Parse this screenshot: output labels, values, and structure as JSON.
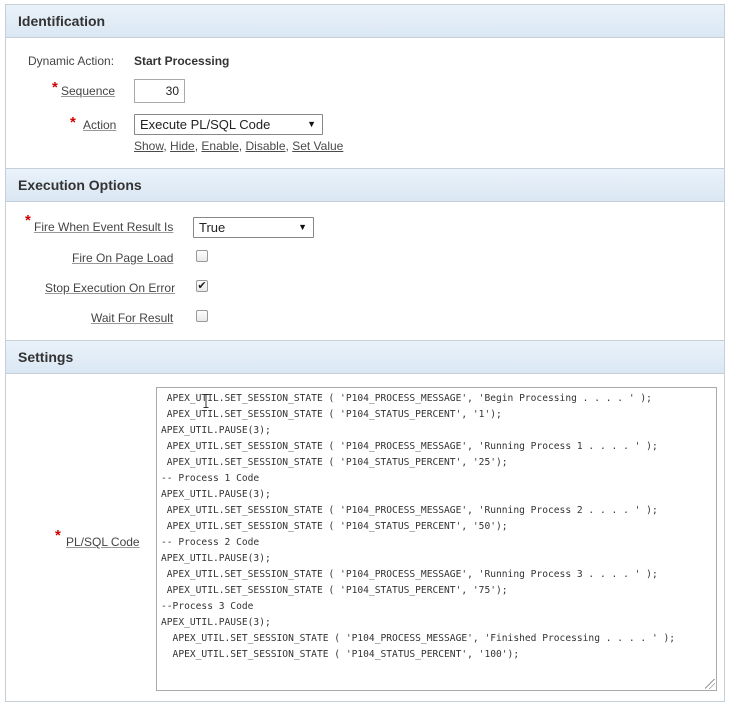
{
  "identification": {
    "header": "Identification",
    "dynamic_action_label": "Dynamic Action:",
    "dynamic_action_value": "Start Processing",
    "sequence_label": "Sequence",
    "sequence_value": "30",
    "action_label": "Action",
    "action_value": "Execute PL/SQL Code",
    "action_links": [
      "Show",
      "Hide",
      "Enable",
      "Disable",
      "Set Value"
    ]
  },
  "execution": {
    "header": "Execution Options",
    "fire_when_label": "Fire When Event Result Is",
    "fire_when_value": "True",
    "fire_on_load_label": "Fire On Page Load",
    "fire_on_load_checked": false,
    "stop_on_error_label": "Stop Execution On Error",
    "stop_on_error_checked": true,
    "wait_for_result_label": "Wait For Result",
    "wait_for_result_checked": false
  },
  "settings": {
    "header": "Settings",
    "plsql_label": "PL/SQL Code",
    "plsql_code": " APEX_UTIL.SET_SESSION_STATE ( 'P104_PROCESS_MESSAGE', 'Begin Processing . . . . ' );\n APEX_UTIL.SET_SESSION_STATE ( 'P104_STATUS_PERCENT', '1');\nAPEX_UTIL.PAUSE(3);\n APEX_UTIL.SET_SESSION_STATE ( 'P104_PROCESS_MESSAGE', 'Running Process 1 . . . . ' );\n APEX_UTIL.SET_SESSION_STATE ( 'P104_STATUS_PERCENT', '25');\n-- Process 1 Code\nAPEX_UTIL.PAUSE(3);\n APEX_UTIL.SET_SESSION_STATE ( 'P104_PROCESS_MESSAGE', 'Running Process 2 . . . . ' );\n APEX_UTIL.SET_SESSION_STATE ( 'P104_STATUS_PERCENT', '50');\n-- Process 2 Code\nAPEX_UTIL.PAUSE(3);\n APEX_UTIL.SET_SESSION_STATE ( 'P104_PROCESS_MESSAGE', 'Running Process 3 . . . . ' );\n APEX_UTIL.SET_SESSION_STATE ( 'P104_STATUS_PERCENT', '75');\n--Process 3 Code\nAPEX_UTIL.PAUSE(3);\n  APEX_UTIL.SET_SESSION_STATE ( 'P104_PROCESS_MESSAGE', 'Finished Processing . . . . ' );\n  APEX_UTIL.SET_SESSION_STATE ( 'P104_STATUS_PERCENT', '100');"
  },
  "symbols": {
    "required_marker": "*",
    "checkmark": "✔",
    "dropdown_arrow": "▼",
    "link_separator": ","
  }
}
